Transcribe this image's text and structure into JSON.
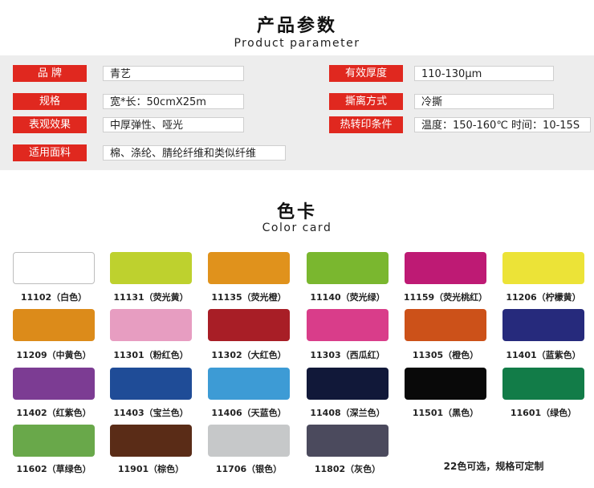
{
  "header": {
    "title_zh": "产品参数",
    "title_en": "Product parameter"
  },
  "params": [
    {
      "label": "品  牌",
      "value": "青艺"
    },
    {
      "label": "有效厚度",
      "value": "110-130μm"
    },
    {
      "label": "规格",
      "value": "宽*长：50cmX25m"
    },
    {
      "label": "撕离方式",
      "value": "冷撕"
    },
    {
      "label": "表观效果",
      "value": "中厚弹性、哑光"
    },
    {
      "label": "热转印条件",
      "value": "温度：150-160℃ 时间：10-15S"
    },
    {
      "label": "适用面料",
      "value": "棉、涤纶、腈纶纤维和类似纤维"
    }
  ],
  "color_card": {
    "title_zh": "色卡",
    "title_en": "Color card",
    "note": "22色可选，规格可定制",
    "swatches": [
      {
        "code": "11102（白色）",
        "color": "#ffffff"
      },
      {
        "code": "11131（荧光黄）",
        "color": "#bed12e"
      },
      {
        "code": "11135（荧光橙）",
        "color": "#e0921c"
      },
      {
        "code": "11140（荧光绿）",
        "color": "#7ab72f"
      },
      {
        "code": "11159（荧光桃红）",
        "color": "#be1a74"
      },
      {
        "code": "11206（柠檬黄）",
        "color": "#ece337"
      },
      {
        "code": "11209（中黄色）",
        "color": "#dc8b1a"
      },
      {
        "code": "11301（粉红色）",
        "color": "#e79dc1"
      },
      {
        "code": "11302（大红色）",
        "color": "#a81e26"
      },
      {
        "code": "11303（西瓜红）",
        "color": "#d93d8a"
      },
      {
        "code": "11305（橙色）",
        "color": "#cc5119"
      },
      {
        "code": "11401（蓝紫色）",
        "color": "#262a7c"
      },
      {
        "code": "11402（红紫色）",
        "color": "#7c3c93"
      },
      {
        "code": "11403（宝兰色）",
        "color": "#1f4c97"
      },
      {
        "code": "11406（天蓝色）",
        "color": "#3d9bd5"
      },
      {
        "code": "11408（深兰色）",
        "color": "#111839"
      },
      {
        "code": "11501（黑色）",
        "color": "#090909"
      },
      {
        "code": "11601（绿色）",
        "color": "#127c48"
      },
      {
        "code": "11602（草绿色）",
        "color": "#69a84a"
      },
      {
        "code": "11901（棕色）",
        "color": "#5a2c17"
      },
      {
        "code": "11706（银色）",
        "color": "#c6c8c9"
      },
      {
        "code": "11802（灰色）",
        "color": "#4b4a5d"
      }
    ]
  }
}
